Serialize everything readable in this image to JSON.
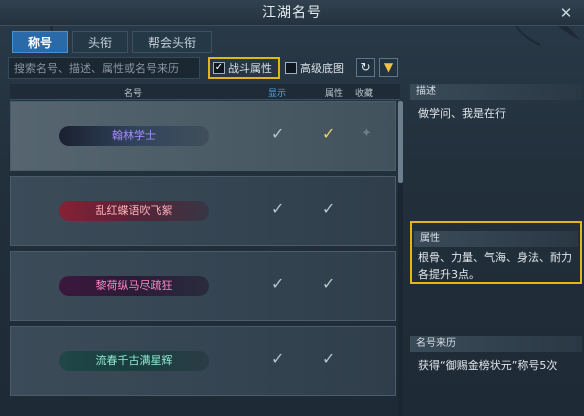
{
  "window": {
    "title": "江湖名号",
    "close_glyph": "✕"
  },
  "tabs": [
    {
      "label": "称号",
      "active": true
    },
    {
      "label": "头衔",
      "active": false
    },
    {
      "label": "帮会头衔",
      "active": false
    }
  ],
  "filters": {
    "search_placeholder": "搜索名号、描述、属性或名号来历",
    "battle_attr": {
      "label": "战斗属性",
      "checked": true,
      "check_glyph": "✓"
    },
    "advanced_bg": {
      "label": "高级底图",
      "checked": false
    },
    "refresh_icon": "↻",
    "filter_icon": "▼"
  },
  "list": {
    "headers": {
      "name": "名号",
      "show": "显示",
      "attr": "属性",
      "fav": "收藏"
    },
    "rows": [
      {
        "title": "翰林学士",
        "show_tick": "✓",
        "attr_tick": "✓",
        "fav_icon": "✦",
        "selected": true
      },
      {
        "title": "乱红蝶语吹飞絮",
        "show_tick": "✓",
        "attr_tick": "✓",
        "fav_icon": "",
        "selected": false
      },
      {
        "title": "黎荷纵马尽疏狂",
        "show_tick": "✓",
        "attr_tick": "✓",
        "fav_icon": "",
        "selected": false
      },
      {
        "title": "流春千古满星辉",
        "show_tick": "✓",
        "attr_tick": "✓",
        "fav_icon": "",
        "selected": false
      }
    ]
  },
  "detail": {
    "desc_title": "描述",
    "desc_text": "做学问、我是在行",
    "attr_title": "属性",
    "attr_text": "根骨、力量、气海、身法、耐力各提升3点。",
    "origin_title": "名号来历",
    "origin_text": "获得“御赐金榜状元”称号5次"
  },
  "colors": {
    "highlight": "#e2b616",
    "tab_active": "#2a6aa8",
    "show_header": "#4fa8e8"
  }
}
